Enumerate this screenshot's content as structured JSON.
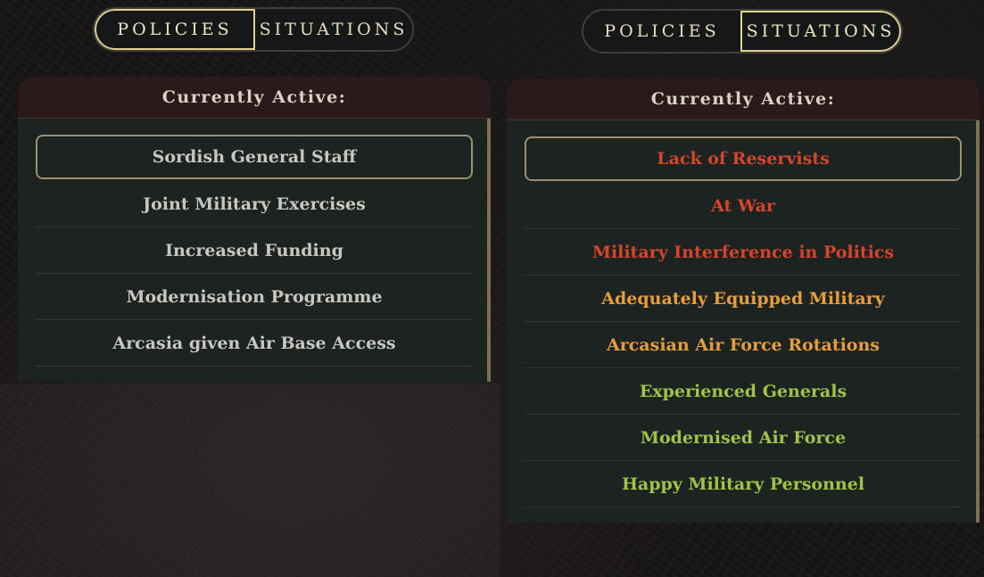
{
  "colors": {
    "neutral": "#c9c6bf",
    "negative": "#d5452c",
    "warning": "#e69d3c",
    "positive": "#9fc346",
    "accent_border": "#e3cf92"
  },
  "left": {
    "tabs": {
      "policies": "POLICIES",
      "situations": "SITUATIONS",
      "active": "policies"
    },
    "header": "Currently Active:",
    "items": [
      {
        "label": "Sordish General Staff",
        "tone": "neutral"
      },
      {
        "label": "Joint Military Exercises",
        "tone": "neutral"
      },
      {
        "label": "Increased Funding",
        "tone": "neutral"
      },
      {
        "label": "Modernisation Programme",
        "tone": "neutral"
      },
      {
        "label": "Arcasia given Air Base Access",
        "tone": "neutral"
      }
    ]
  },
  "right": {
    "tabs": {
      "policies": "POLICIES",
      "situations": "SITUATIONS",
      "active": "situations"
    },
    "header": "Currently Active:",
    "items": [
      {
        "label": "Lack of Reservists",
        "tone": "negative"
      },
      {
        "label": "At War",
        "tone": "negative"
      },
      {
        "label": "Military Interference in Politics",
        "tone": "negative"
      },
      {
        "label": "Adequately Equipped Military",
        "tone": "warning"
      },
      {
        "label": "Arcasian Air Force Rotations",
        "tone": "warning"
      },
      {
        "label": "Experienced Generals",
        "tone": "positive"
      },
      {
        "label": "Modernised Air Force",
        "tone": "positive"
      },
      {
        "label": "Happy Military Personnel",
        "tone": "positive"
      }
    ]
  }
}
